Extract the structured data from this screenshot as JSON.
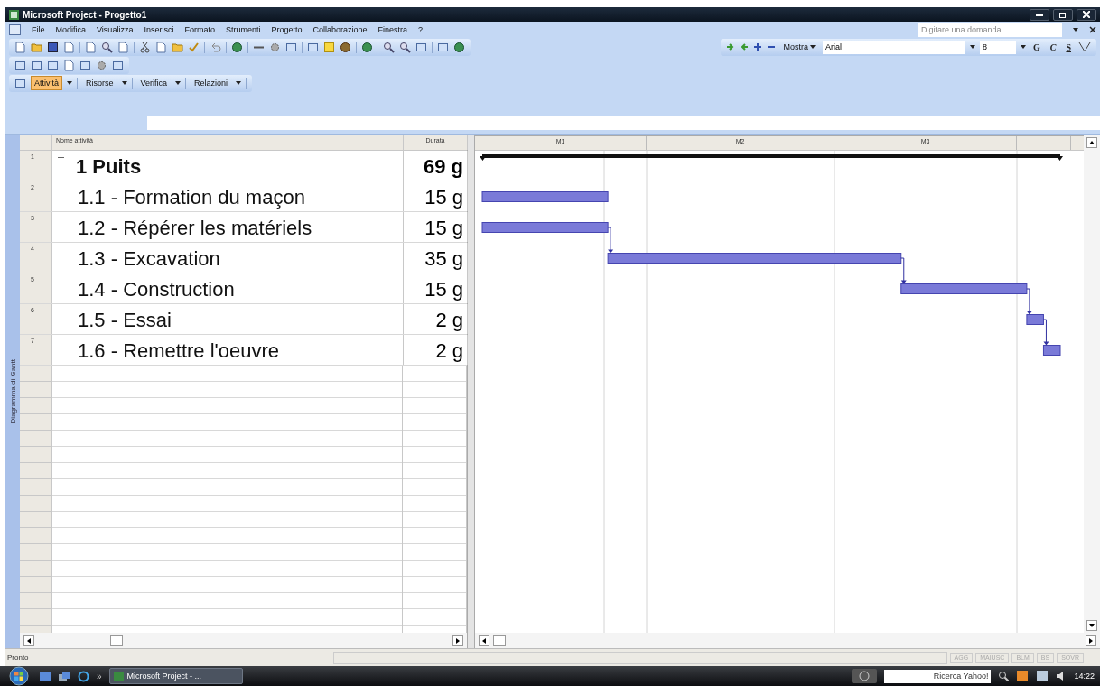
{
  "window": {
    "title": "Microsoft Project - Progetto1"
  },
  "menu": [
    {
      "label": "File"
    },
    {
      "label": "Modifica"
    },
    {
      "label": "Visualizza"
    },
    {
      "label": "Inserisci"
    },
    {
      "label": "Formato"
    },
    {
      "label": "Strumenti"
    },
    {
      "label": "Progetto"
    },
    {
      "label": "Collaborazione"
    },
    {
      "label": "Finestra"
    },
    {
      "label": "?"
    }
  ],
  "help_box": {
    "placeholder": "Digitare una domanda."
  },
  "formatting_toolbar": {
    "show_button": "Mostra",
    "font": "Arial",
    "size": "8",
    "bold": "G",
    "italic": "C",
    "underline": "S"
  },
  "guide_toolbar": [
    {
      "label": "Attività",
      "selected": true
    },
    {
      "label": "Risorse",
      "selected": false
    },
    {
      "label": "Verifica",
      "selected": false
    },
    {
      "label": "Relazioni",
      "selected": false
    }
  ],
  "view_bar": {
    "label": "Diagramma di Gantt"
  },
  "table": {
    "columns": [
      "Nome attività",
      "Durata"
    ],
    "rows": [
      {
        "number": "1",
        "name": "1 Puits",
        "duration": "69 g",
        "expanded": true,
        "children": [
          {
            "number": "2",
            "name": "1.1 - Formation du maçon",
            "duration": "15 g",
            "linked": false
          },
          {
            "number": "3",
            "name": "1.2 - Répérer les matériels",
            "duration": "15 g",
            "linked": false
          },
          {
            "number": "4",
            "name": "1.3 - Excavation",
            "duration": "35 g",
            "linked": true
          },
          {
            "number": "5",
            "name": "1.4 - Construction",
            "duration": "15 g",
            "linked": true
          },
          {
            "number": "6",
            "name": "1.5 - Essai",
            "duration": "2 g",
            "linked": true
          },
          {
            "number": "7",
            "name": "1.6 - Remettre l'oeuvre",
            "duration": "2 g",
            "linked": true
          }
        ]
      }
    ]
  },
  "timescale": [
    "M1",
    "M2",
    "M3"
  ],
  "status_bar": {
    "text": "Pronto",
    "indicators": [
      "AGG",
      "MAIUSC",
      "BLM",
      "BS",
      "SOVR"
    ]
  },
  "taskbar": {
    "more": "»",
    "task_button": "Microsoft Project - ...",
    "search": {
      "placeholder": "Ricerca Yahoo!"
    },
    "clock": "14:22"
  }
}
